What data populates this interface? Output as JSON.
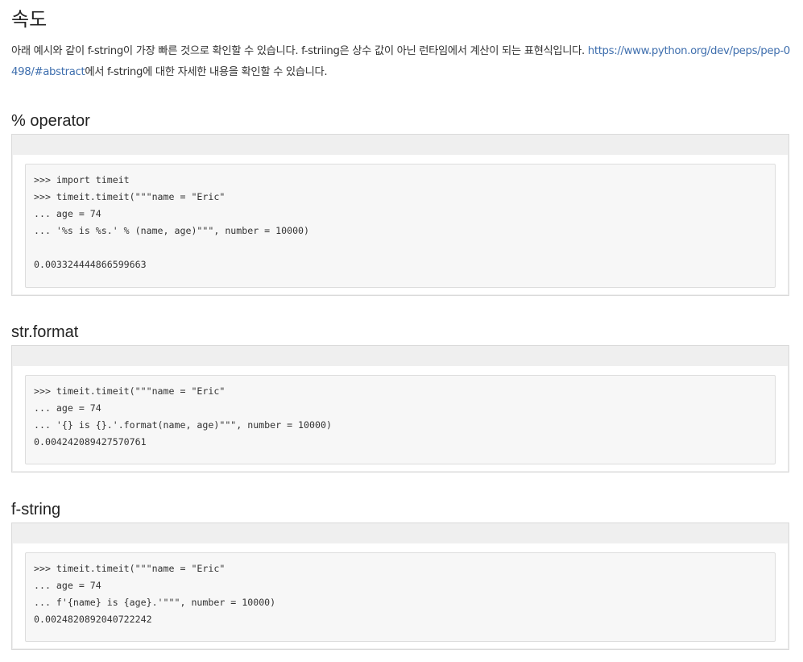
{
  "title": "속도",
  "intro": {
    "text_before_link": "아래 예시와 같이 f-string이 가장 빠른 것으로 확인할 수 있습니다. f-striing은 상수 값이 아닌 런타임에서 계산이 되는 표현식입니다. ",
    "link_text": "https://www.python.org/dev/peps/pep-0498/#abstract",
    "text_after_link": "에서 f-string에 대한 자세한 내용을 확인할 수 있습니다."
  },
  "sections": [
    {
      "heading": "% operator",
      "code": [
        ">>> import timeit",
        ">>> timeit.timeit(\"\"\"name = \"Eric\"",
        "... age = 74",
        "... '%s is %s.' % (name, age)\"\"\", number = 10000)",
        "",
        "0.003324444866599663"
      ]
    },
    {
      "heading": "str.format",
      "code": [
        ">>> timeit.timeit(\"\"\"name = \"Eric\"",
        "... age = 74",
        "... '{} is {}.'.format(name, age)\"\"\", number = 10000)",
        "0.004242089427570761"
      ]
    },
    {
      "heading": "f-string",
      "code": [
        ">>> timeit.timeit(\"\"\"name = \"Eric\"",
        "... age = 74",
        "... f'{name} is {age}.'\"\"\", number = 10000)",
        "0.0024820892040722242"
      ]
    }
  ]
}
